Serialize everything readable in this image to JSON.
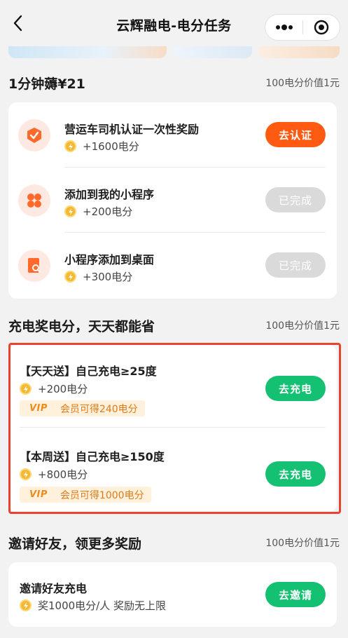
{
  "header": {
    "title": "云辉融电-电分任务",
    "back_icon": "chevron-left-icon",
    "more_icon": "more-dots-icon",
    "close_icon": "target-circle-icon"
  },
  "section1": {
    "title": "1分钟薅¥21",
    "note": "100电分价值1元",
    "tasks": [
      {
        "title": "营运车司机认证一次性奖励",
        "reward": "+1600电分",
        "button": "去认证",
        "icon": "shield-check-icon"
      },
      {
        "title": "添加到我的小程序",
        "reward": "+200电分",
        "button": "已完成",
        "icon": "apps-grid-icon"
      },
      {
        "title": "小程序添加到桌面",
        "reward": "+300电分",
        "button": "已完成",
        "icon": "desktop-shortcut-icon"
      }
    ]
  },
  "section2": {
    "title": "充电奖电分，天天都能省",
    "note": "100电分价值1元",
    "tasks": [
      {
        "title": "【天天送】自己充电≥25度",
        "reward": "+200电分",
        "vip_logo": "VIP",
        "vip_text": "会员可得240电分",
        "button": "去充电"
      },
      {
        "title": "【本周送】自己充电≥150度",
        "reward": "+800电分",
        "vip_logo": "VIP",
        "vip_text": "会员可得1000电分",
        "button": "去充电"
      }
    ]
  },
  "section3": {
    "title": "邀请好友，领更多奖励",
    "note": "100电分价值1元",
    "tasks": [
      {
        "title": "邀请好友充电",
        "reward": "奖1000电分/人 奖励无上限",
        "button": "去邀请"
      }
    ]
  },
  "colors": {
    "accent_orange": "#ff5a12",
    "accent_green": "#14c173",
    "disabled_gray": "#dadada",
    "highlight_red": "#e8432f",
    "coin_gold": "#f7b731"
  }
}
